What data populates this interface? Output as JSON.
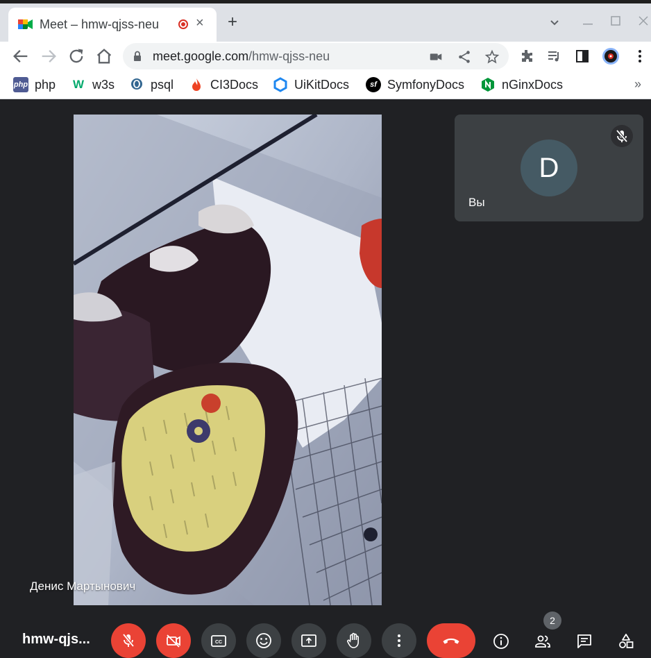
{
  "browser": {
    "tab": {
      "title": "Meet – hmw-qjss-neu",
      "favicon": "google-meet-icon",
      "recording_indicator": "recording-dot-icon",
      "close": "×"
    },
    "new_tab": "+",
    "window_controls": {
      "tab_search": "⌄",
      "minimize": "—",
      "maximize": "☐",
      "close": "✕"
    },
    "nav": {
      "back": "←",
      "forward": "→",
      "reload": "↻",
      "home": "⌂"
    },
    "url": {
      "host": "meet.google.com",
      "path": "/hmw-qjss-neu"
    },
    "bookmarks": [
      {
        "label": "php",
        "icon": "php-icon"
      },
      {
        "label": "w3s",
        "icon": "w3schools-icon"
      },
      {
        "label": "psql",
        "icon": "postgresql-icon"
      },
      {
        "label": "CI3Docs",
        "icon": "codeigniter-icon"
      },
      {
        "label": "UiKitDocs",
        "icon": "uikit-icon"
      },
      {
        "label": "SymfonyDocs",
        "icon": "symfony-icon"
      },
      {
        "label": "nGinxDocs",
        "icon": "nginx-icon"
      }
    ],
    "bookmarks_more": "»"
  },
  "meet": {
    "main_participant": {
      "name": "Денис Мартынович"
    },
    "self_tile": {
      "initial": "D",
      "label": "Вы",
      "muted": true
    },
    "meeting_code": "hmw-qjs...",
    "participant_count": "2",
    "colors": {
      "background": "#202124",
      "tile": "#3c4043",
      "danger": "#ea4335",
      "avatar": "#455a64"
    }
  }
}
